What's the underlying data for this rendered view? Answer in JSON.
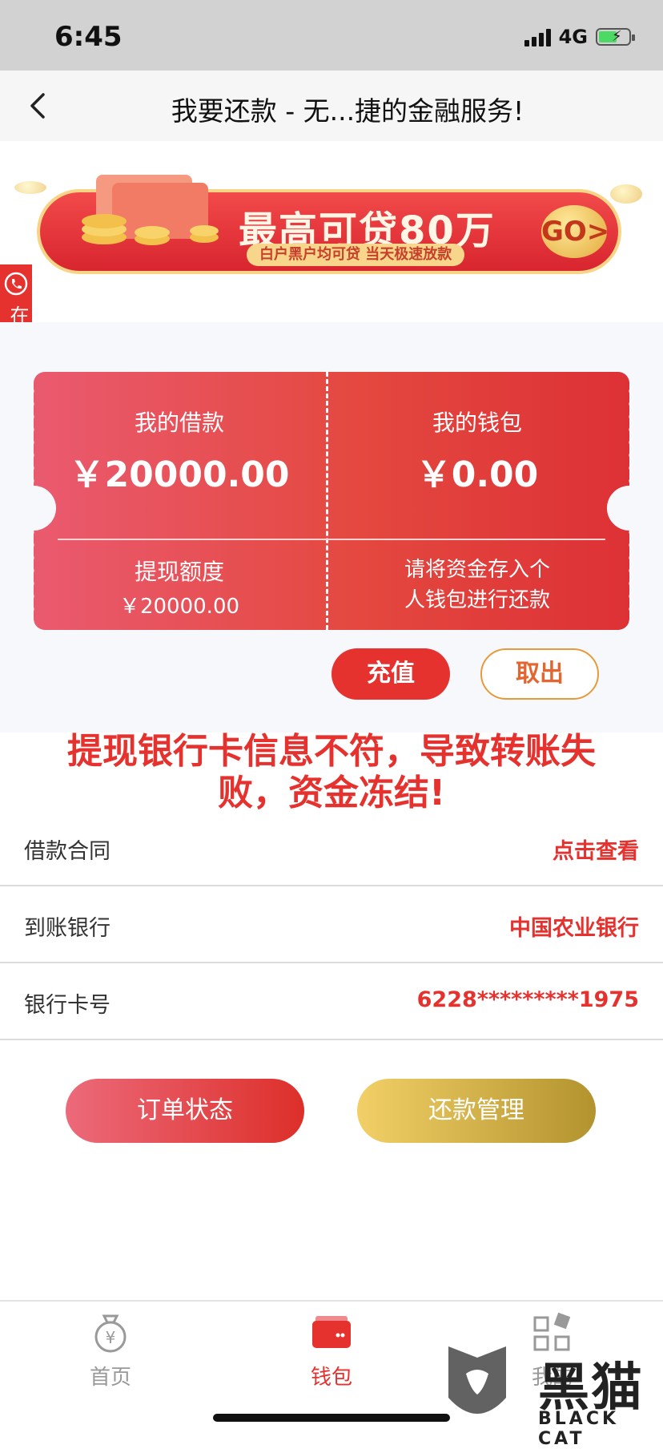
{
  "status_bar": {
    "time": "6:45",
    "network": "4G"
  },
  "nav": {
    "title": "我要还款 - 无...捷的金融服务!"
  },
  "banner": {
    "title": "最高可贷80万",
    "subtitle": "白户黑户均可贷 当天极速放款",
    "go_label": "GO>"
  },
  "service_tab": {
    "label": "在线客服"
  },
  "ticket": {
    "loan_label": "我的借款",
    "loan_amount": "￥20000.00",
    "wallet_label": "我的钱包",
    "wallet_amount": "￥0.00",
    "quota_label": "提现额度",
    "quota_amount": "￥20000.00",
    "note_line1": "请将资金存入个",
    "note_line2": "人钱包进行还款"
  },
  "actions": {
    "recharge": "充值",
    "withdraw": "取出"
  },
  "warning": {
    "line1": "提现银行卡信息不符，导致转账失",
    "line2": "败，资金冻结!"
  },
  "info_rows": [
    {
      "label": "借款合同",
      "value": "点击查看"
    },
    {
      "label": "到账银行",
      "value": "中国农业银行"
    },
    {
      "label": "银行卡号",
      "value": "6228*********1975"
    }
  ],
  "bottom_buttons": {
    "order_status": "订单状态",
    "repay_manage": "还款管理"
  },
  "tabbar": [
    {
      "label": "首页",
      "icon": "money-bag-icon"
    },
    {
      "label": "钱包",
      "icon": "wallet-icon"
    },
    {
      "label": "我的",
      "icon": "grid-icon"
    }
  ],
  "watermark": {
    "text": "黑猫",
    "sub": "BLACK CAT"
  },
  "colors": {
    "accent": "#e5322e",
    "gold": "#c9a93f"
  }
}
